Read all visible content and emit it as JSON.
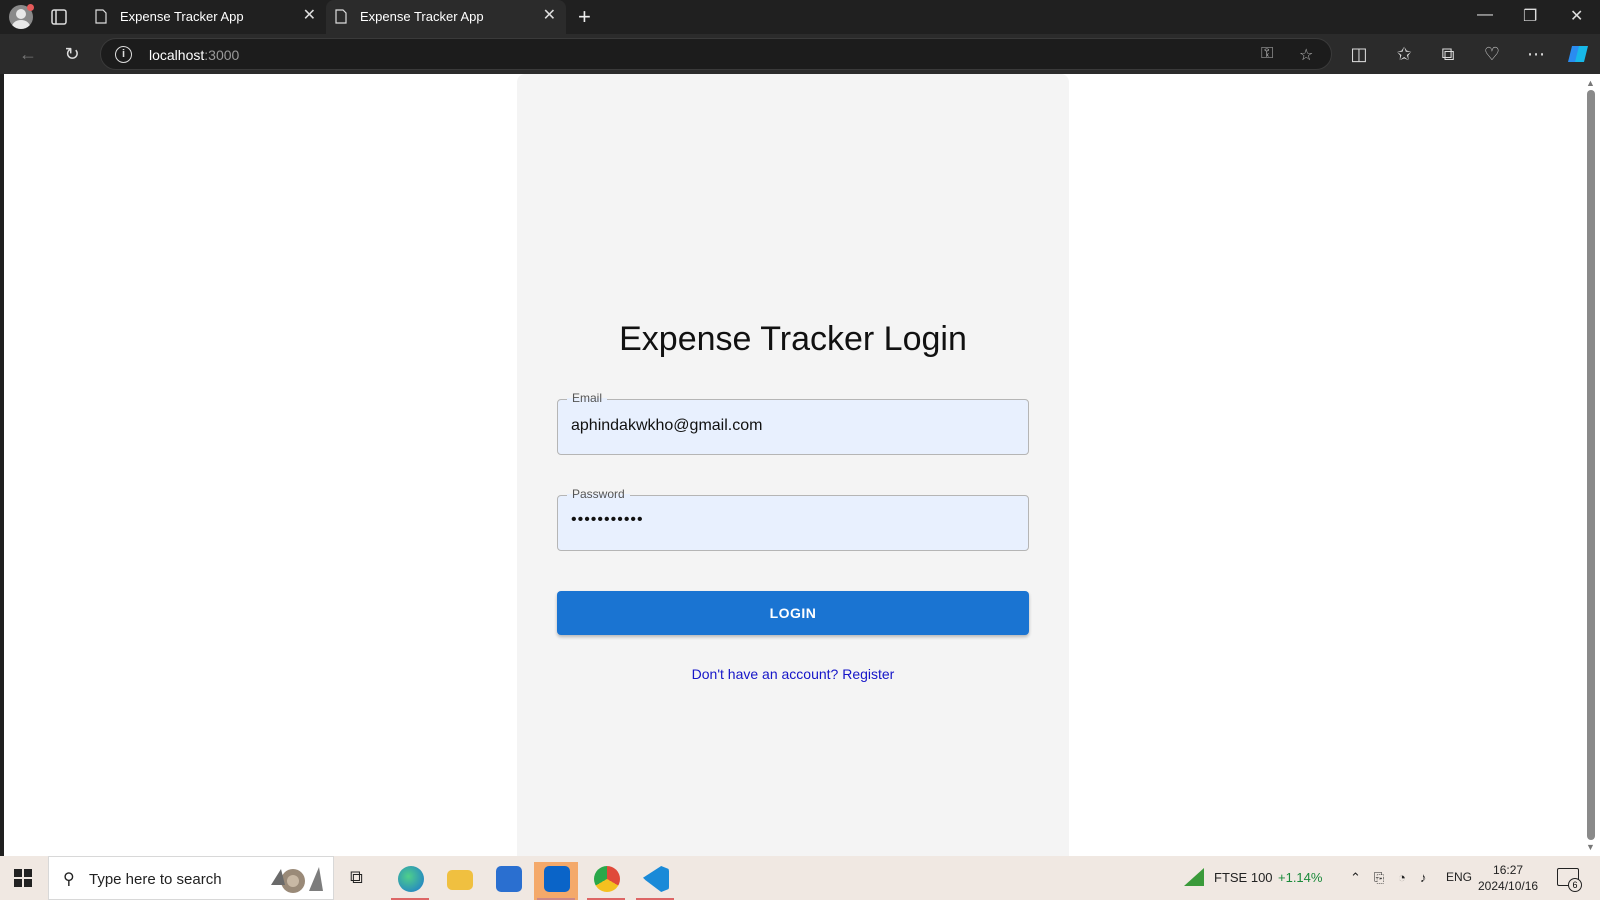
{
  "browser": {
    "tabs": [
      {
        "label": "Expense Tracker App",
        "close": "✕"
      },
      {
        "label": "Expense Tracker App",
        "close": "✕"
      }
    ],
    "new_tab": "+",
    "address": {
      "host": "localhost",
      "port": ":3000"
    }
  },
  "page": {
    "title": "Expense Tracker Login",
    "email": {
      "label": "Email",
      "value": "aphindakwkho@gmail.com"
    },
    "password": {
      "label": "Password",
      "value": "•••••••••••"
    },
    "login_label": "LOGIN",
    "register_link": "Don't have an account? Register"
  },
  "taskbar": {
    "search_placeholder": "Type here to search",
    "ticker": {
      "name": "FTSE 100",
      "change": "+1.14%"
    },
    "language": "ENG",
    "time": "16:27",
    "date": "2024/10/16",
    "notifications": "6"
  },
  "colors": {
    "accent": "#1a74d2",
    "link": "#1515c8",
    "ticker_up": "#1a8a3a"
  }
}
